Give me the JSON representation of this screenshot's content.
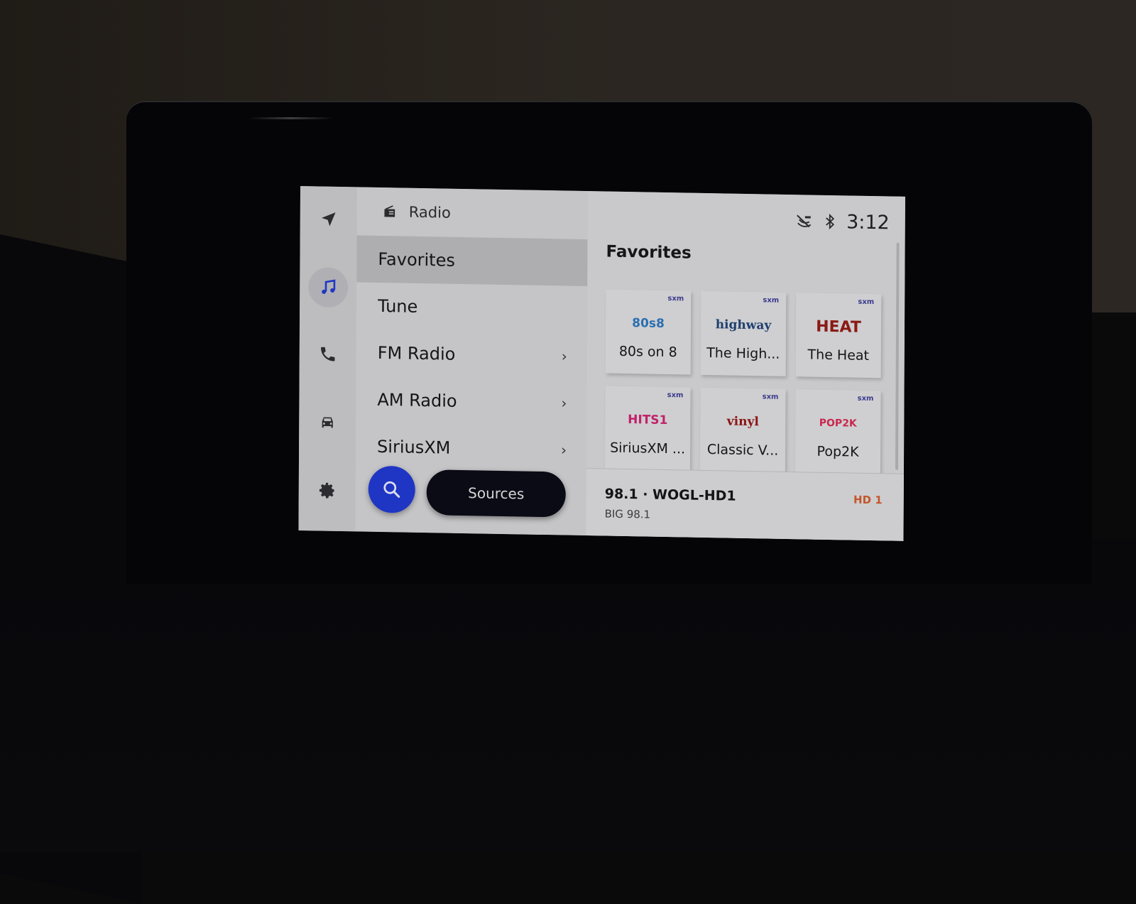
{
  "rail": {
    "items": [
      {
        "name": "navigation",
        "icon": "navigation-arrow-icon",
        "active": false
      },
      {
        "name": "media",
        "icon": "music-note-icon",
        "active": true
      },
      {
        "name": "phone",
        "icon": "phone-icon",
        "active": false
      },
      {
        "name": "vehicle",
        "icon": "car-icon",
        "active": false
      },
      {
        "name": "settings",
        "icon": "gear-icon",
        "active": false
      }
    ],
    "active_color": "#1f36c4"
  },
  "menu": {
    "header": {
      "icon": "radio-icon",
      "title": "Radio"
    },
    "items": [
      {
        "label": "Favorites",
        "selected": true,
        "has_chevron": false
      },
      {
        "label": "Tune",
        "selected": false,
        "has_chevron": false
      },
      {
        "label": "FM Radio",
        "selected": false,
        "has_chevron": true
      },
      {
        "label": "AM Radio",
        "selected": false,
        "has_chevron": true
      },
      {
        "label": "SiriusXM",
        "selected": false,
        "has_chevron": true
      }
    ],
    "chevron": "›",
    "search_icon": "search-icon",
    "sources_label": "Sources"
  },
  "status": {
    "icons": [
      "voice-disabled-icon",
      "bluetooth-icon"
    ],
    "time": "3:12"
  },
  "content": {
    "title": "Favorites",
    "tiles": [
      {
        "label": "80s on 8",
        "logo_text": "80s8",
        "logo_color": "#2a6fb0",
        "badge": "sxm"
      },
      {
        "label": "The High...",
        "logo_text": "highway",
        "logo_color": "#1f3f6e",
        "badge": "sxm"
      },
      {
        "label": "The Heat",
        "logo_text": "HEAT",
        "logo_color": "#8a1a14",
        "badge": "sxm"
      },
      {
        "label": "SiriusXM ...",
        "logo_text": "HITS1",
        "logo_color": "#c0226a",
        "badge": "sxm"
      },
      {
        "label": "Classic V...",
        "logo_text": "vinyl",
        "logo_color": "#8a1414",
        "badge": "sxm"
      },
      {
        "label": "Pop2K",
        "logo_text": "POP2K",
        "logo_color": "#c8284e",
        "badge": "sxm"
      }
    ]
  },
  "now_playing": {
    "title": "98.1 · WOGL-HD1",
    "subtitle": "BIG 98.1",
    "hd_badge": "HD 1",
    "hd_color": "#c4562c"
  }
}
